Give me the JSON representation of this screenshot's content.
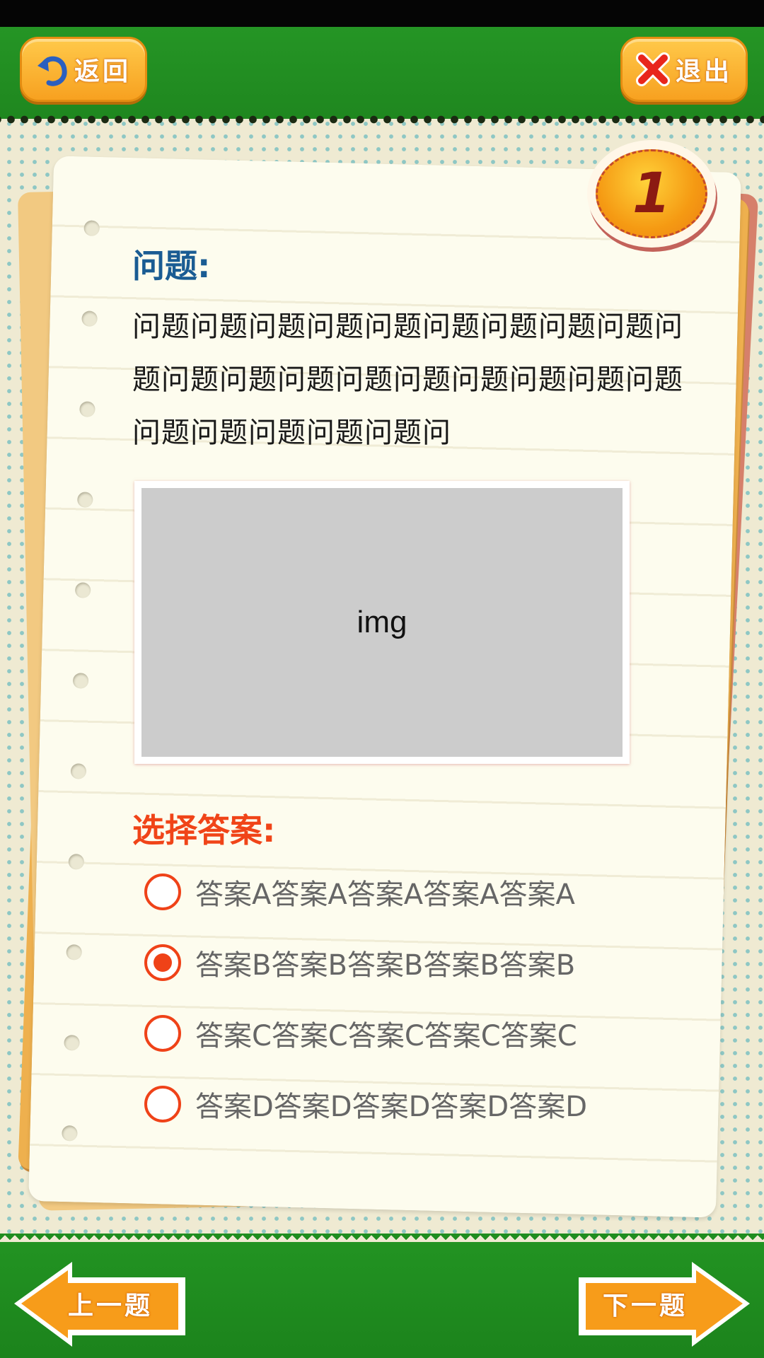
{
  "header": {
    "back_label": "返回",
    "exit_label": "退出"
  },
  "question": {
    "number": "1",
    "heading": "问题:",
    "text": "问题问题问题问题问题问题问题问题问题问题问题问题问题问题问题问题问题问题问题问题问题问题问题问题问",
    "image_label": "img"
  },
  "answers": {
    "heading": "选择答案:",
    "options": [
      {
        "label": "答案A答案A答案A答案A答案A",
        "selected": false
      },
      {
        "label": "答案B答案B答案B答案B答案B",
        "selected": true
      },
      {
        "label": "答案C答案C答案C答案C答案C",
        "selected": false
      },
      {
        "label": "答案D答案D答案D答案D答案D",
        "selected": false
      }
    ]
  },
  "footer": {
    "prev_label": "上一题",
    "next_label": "下一题"
  },
  "colors": {
    "header_green": "#259525",
    "button_orange": "#f7a120",
    "question_heading_blue": "#1a5c93",
    "answer_heading_red": "#f04418"
  }
}
